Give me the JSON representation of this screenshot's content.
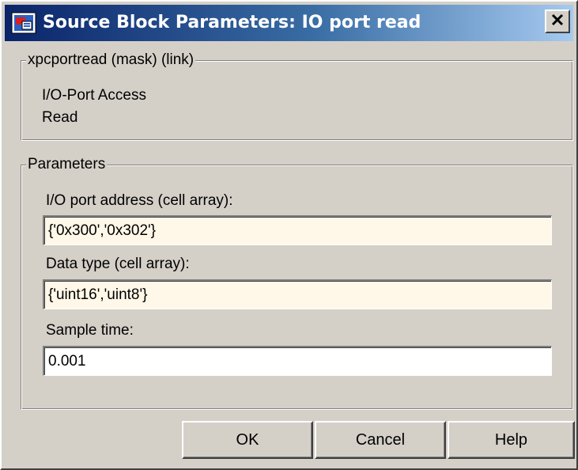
{
  "window": {
    "title": "Source Block Parameters: IO port read",
    "icon": "simulink-block-icon",
    "close_icon": "close-icon"
  },
  "description_group": {
    "legend": "xpcportread (mask) (link)",
    "lines": [
      "I/O-Port Access",
      "Read"
    ]
  },
  "parameters_group": {
    "legend": "Parameters",
    "fields": [
      {
        "label": "I/O port address (cell array):",
        "value": "{'0x300','0x302'}"
      },
      {
        "label": "Data type (cell array):",
        "value": "{'uint16','uint8'}"
      },
      {
        "label": "Sample time:",
        "value": "0.001"
      }
    ]
  },
  "buttons": {
    "ok": "OK",
    "cancel": "Cancel",
    "help": "Help"
  },
  "colors": {
    "dialog_bg": "#d4d0c8",
    "title_gradient_start": "#0a246a",
    "title_gradient_end": "#a6caf0",
    "evaluated_field_bg": "#fff7e8"
  }
}
